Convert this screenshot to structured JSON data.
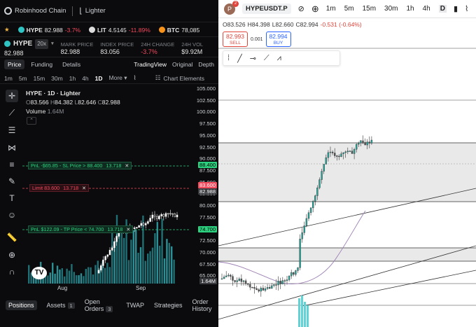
{
  "left_app": {
    "brand": "Robinhood Chain",
    "brand2": "Lighter",
    "ticker": [
      {
        "sym": "HYPE",
        "price": "82.988",
        "chg": "-3.7%"
      },
      {
        "sym": "LIT",
        "price": "4.5145",
        "chg": "-11.89%"
      },
      {
        "sym": "BTC",
        "price": "78,085"
      }
    ],
    "pair": "HYPE",
    "leverage": "20x",
    "last_price": "82.988",
    "stats": [
      {
        "label": "MARK PRICE",
        "value": "82.988"
      },
      {
        "label": "INDEX PRICE",
        "value": "83.056"
      },
      {
        "label": "24H CHANGE",
        "value": "-3.7%"
      },
      {
        "label": "24H VOL",
        "value": "$9.92M"
      }
    ],
    "tabs": [
      "Price",
      "Funding",
      "Details"
    ],
    "view_tabs": [
      "TradingView",
      "Original",
      "Depth"
    ],
    "timeframes": [
      "1m",
      "5m",
      "15m",
      "30m",
      "1h",
      "4h",
      "1D",
      "More"
    ],
    "chart_elements": "Chart Elements",
    "legend_title": "HYPE · 1D · Lighter",
    "ohlc": {
      "o": "83.566",
      "h": "84.382",
      "l": "82.646",
      "c": "82.988"
    },
    "volume_label": "Volume",
    "volume_value": "1.64M",
    "axis_labels": [
      "105.000",
      "102.500",
      "100.000",
      "97.500",
      "95.000",
      "92.500",
      "90.000",
      "87.500",
      "85.000",
      "82.500",
      "80.000",
      "77.500",
      "75.000",
      "72.500",
      "70.000",
      "67.500",
      "65.000"
    ],
    "axis_tags": {
      "sl": "88.400",
      "limit": "83.600",
      "last": "82.988",
      "tp": "74.700",
      "vol": "1.64M"
    },
    "orders": {
      "sl": {
        "text": "PnL -$65.85 - SL Price > 88.400",
        "qty": "13.718"
      },
      "limit": {
        "text": "Limit 83.600",
        "qty": "13.718"
      },
      "tp": {
        "text": "PnL $122.09 - TP Price < 74.700",
        "qty": "13.718"
      }
    },
    "months": [
      "Aug",
      "Sep"
    ],
    "bottom_tabs": [
      {
        "label": "Positions"
      },
      {
        "label": "Assets",
        "count": "1"
      },
      {
        "label": "Open Orders",
        "count": "3"
      },
      {
        "label": "TWAP"
      },
      {
        "label": "Strategies"
      },
      {
        "label": "Order History"
      }
    ]
  },
  "right_app": {
    "avatar_letter": "P",
    "notif": "2",
    "symbol": "HYPEUSDT.P",
    "timeframes": [
      "1m",
      "5m",
      "15m",
      "30m",
      "1h",
      "4h",
      "D"
    ],
    "ohlc": {
      "o": "O83.526",
      "h": "H84.398",
      "l": "L82.660",
      "c": "C82.994",
      "chg": "-0.531 (-0.64%)"
    },
    "sell_price": "82.993",
    "sell_label": "SELL",
    "spread": "0.001",
    "buy_price": "82.994",
    "buy_label": "BUY"
  },
  "colors": {
    "up": "#2bd17e",
    "down": "#f2495c",
    "teal": "#2fc3c4",
    "tv_blue": "#2962ff"
  }
}
